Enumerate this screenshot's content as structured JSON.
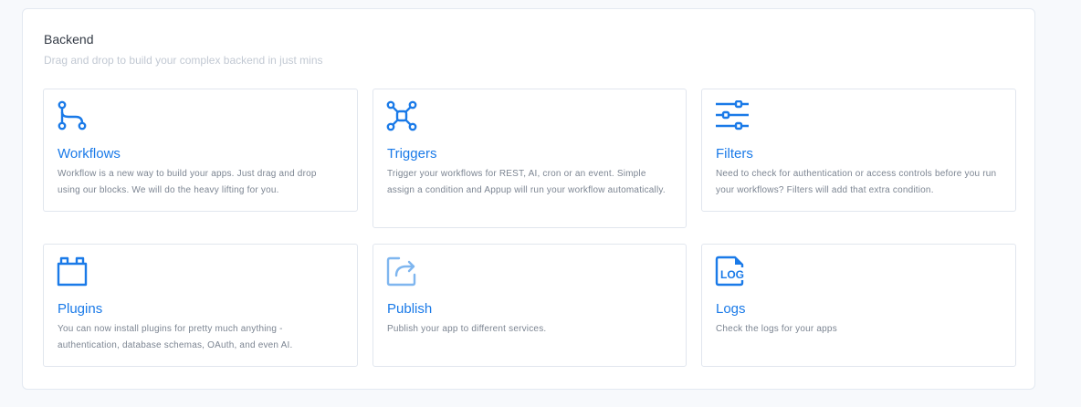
{
  "section": {
    "title": "Backend",
    "subtitle": "Drag and drop to build your complex backend in just mins"
  },
  "cards": [
    {
      "title": "Workflows",
      "icon": "workflow-icon",
      "description": "Workflow is a new way to build your apps. Just drag and drop using our blocks. We will do the heavy lifting for you."
    },
    {
      "title": "Triggers",
      "icon": "triggers-icon",
      "description": "Trigger your workflows for REST, AI, cron or an event. Simple assign a condition and Appup will run your workflow automatically."
    },
    {
      "title": "Filters",
      "icon": "filters-icon",
      "description": "Need to check for authentication or access controls before you run your workflows? Filters will add that extra condition."
    },
    {
      "title": "Plugins",
      "icon": "plugins-icon",
      "description": "You can now install plugins for pretty much anything - authentication, database schemas, OAuth, and even AI."
    },
    {
      "title": "Publish",
      "icon": "publish-icon",
      "description": "Publish your app to different services."
    },
    {
      "title": "Logs",
      "icon": "logs-icon",
      "icon_text": "LOG",
      "description": "Check the logs for your apps"
    }
  ],
  "colors": {
    "accent": "#1a7ae8",
    "publish_icon": "#7fb6ef"
  }
}
